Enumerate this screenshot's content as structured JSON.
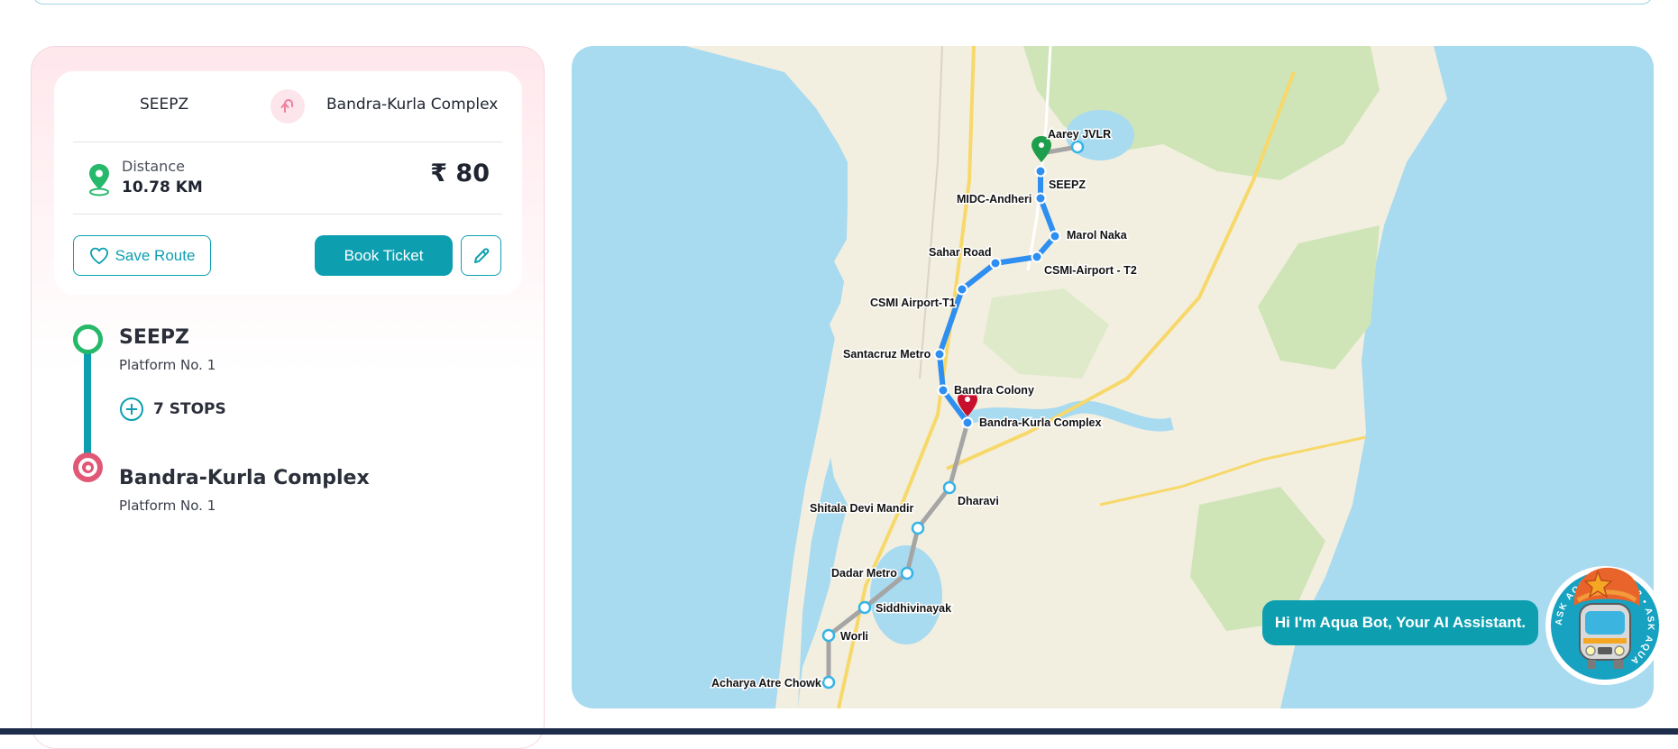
{
  "route": {
    "from": "SEEPZ",
    "to": "Bandra-Kurla Complex",
    "distance_label": "Distance",
    "distance_value": "10.78 KM",
    "fare": "₹ 80"
  },
  "actions": {
    "save_label": "Save Route",
    "book_label": "Book Ticket"
  },
  "journey": {
    "start_name": "SEEPZ",
    "start_platform": "Platform No. 1",
    "stops_label": "7 STOPS",
    "end_name": "Bandra-Kurla Complex",
    "end_platform": "Platform No. 1"
  },
  "map": {
    "station_labels": {
      "aarey": "Aarey JVLR",
      "seepz": "SEEPZ",
      "midc": "MIDC-Andheri",
      "marol": "Marol Naka",
      "sahar": "Sahar Road",
      "t2": "CSMI-Airport - T2",
      "t1": "CSMI Airport-T1",
      "santacruz": "Santacruz Metro",
      "bandra_colony": "Bandra Colony",
      "bkc": "Bandra-Kurla Complex",
      "dharavi": "Dharavi",
      "shitala": "Shitala Devi Mandir",
      "dadar": "Dadar Metro",
      "siddhivinayak": "Siddhivinayak",
      "worli": "Worli",
      "acharya": "Acharya Atre Chowk"
    },
    "colors": {
      "water": "#a8daf0",
      "land": "#f3efe0",
      "park": "#cfe5b8",
      "active_route": "#2f8ff0",
      "inactive_route": "#a5a5a5"
    }
  },
  "bot": {
    "greeting": "Hi I'm Aqua Bot, Your AI Assistant.",
    "badge_text": "ASK AQUA • LINE 3 • ASK AQUA"
  },
  "colors": {
    "brand": "#0d9fb0",
    "start": "#27b96a",
    "end": "#e05875"
  }
}
